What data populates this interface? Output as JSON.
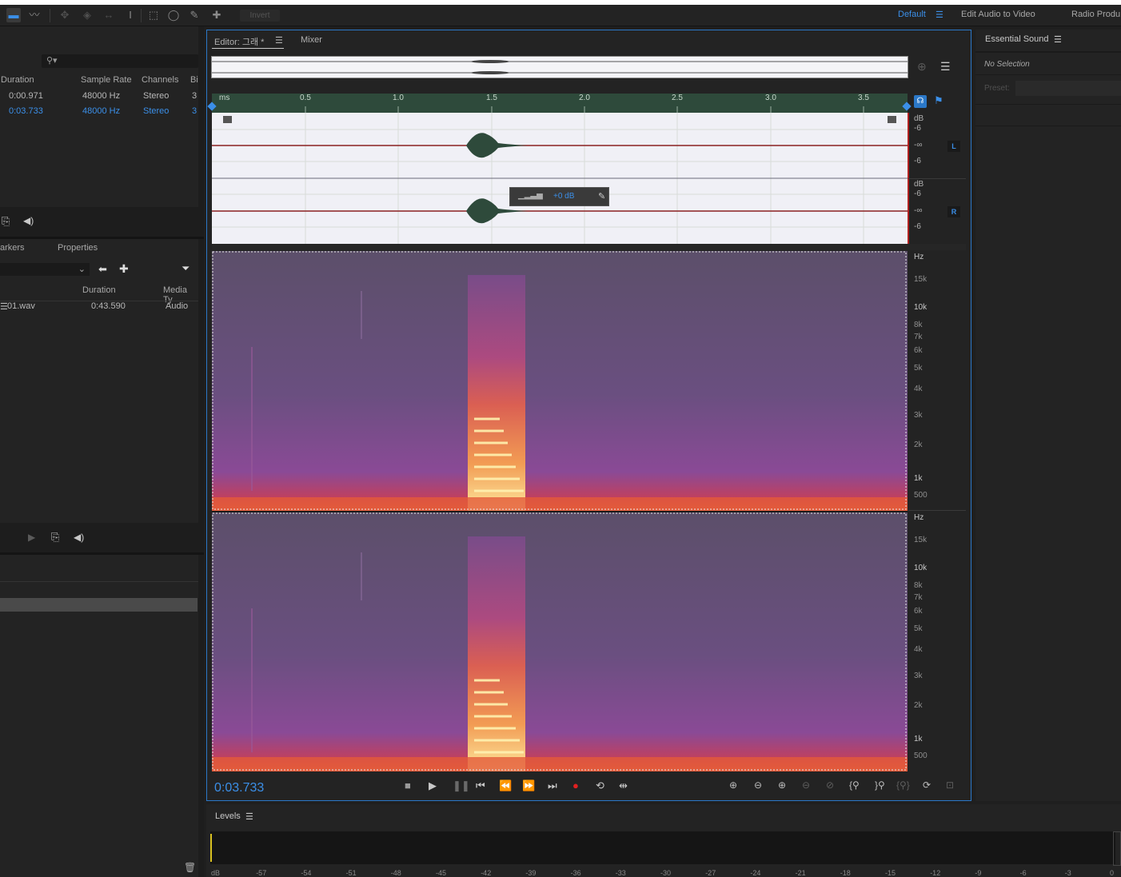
{
  "toolbar": {
    "invert_label": "Invert",
    "workspaces": [
      "Default",
      "Edit Audio to Video",
      "Radio Produ"
    ]
  },
  "files_panel": {
    "columns": [
      "Duration",
      "Sample Rate",
      "Channels",
      "Bi"
    ],
    "rows": [
      {
        "duration": "0:00.971",
        "rate": "48000 Hz",
        "channels": "Stereo",
        "bits": "3"
      },
      {
        "duration": "0:03.733",
        "rate": "48000 Hz",
        "channels": "Stereo",
        "bits": "3"
      }
    ]
  },
  "markers_panel": {
    "tabs": [
      "arkers",
      "Properties"
    ],
    "columns": [
      "Duration",
      "Media Ty"
    ],
    "rows": [
      {
        "name": "01.wav",
        "duration": "0:43.590",
        "type": "Audio"
      }
    ]
  },
  "editor": {
    "tab_label": "Editor: 그래 *",
    "mixer_label": "Mixer",
    "time_display": "0:03.733",
    "ruler_unit": "ms",
    "ruler_ticks": [
      "0.5",
      "1.0",
      "1.5",
      "2.0",
      "2.5",
      "3.0",
      "3.5"
    ],
    "channel_labels": [
      "L",
      "R"
    ],
    "db_labels": [
      "dB",
      "-6",
      "-∞",
      "-6"
    ],
    "hud_value": "+0 dB",
    "hz_labels": [
      "Hz",
      "15k",
      "10k",
      "8k",
      "7k",
      "6k",
      "5k",
      "4k",
      "3k",
      "2k",
      "1k",
      "500"
    ]
  },
  "essential_sound": {
    "title": "Essential Sound",
    "no_selection": "No Selection",
    "preset_label": "Preset:"
  },
  "levels": {
    "title": "Levels",
    "scale": [
      "dB",
      "-57",
      "-54",
      "-51",
      "-48",
      "-45",
      "-42",
      "-39",
      "-36",
      "-33",
      "-30",
      "-27",
      "-24",
      "-21",
      "-18",
      "-15",
      "-12",
      "-9",
      "-6",
      "-3",
      "0"
    ]
  }
}
